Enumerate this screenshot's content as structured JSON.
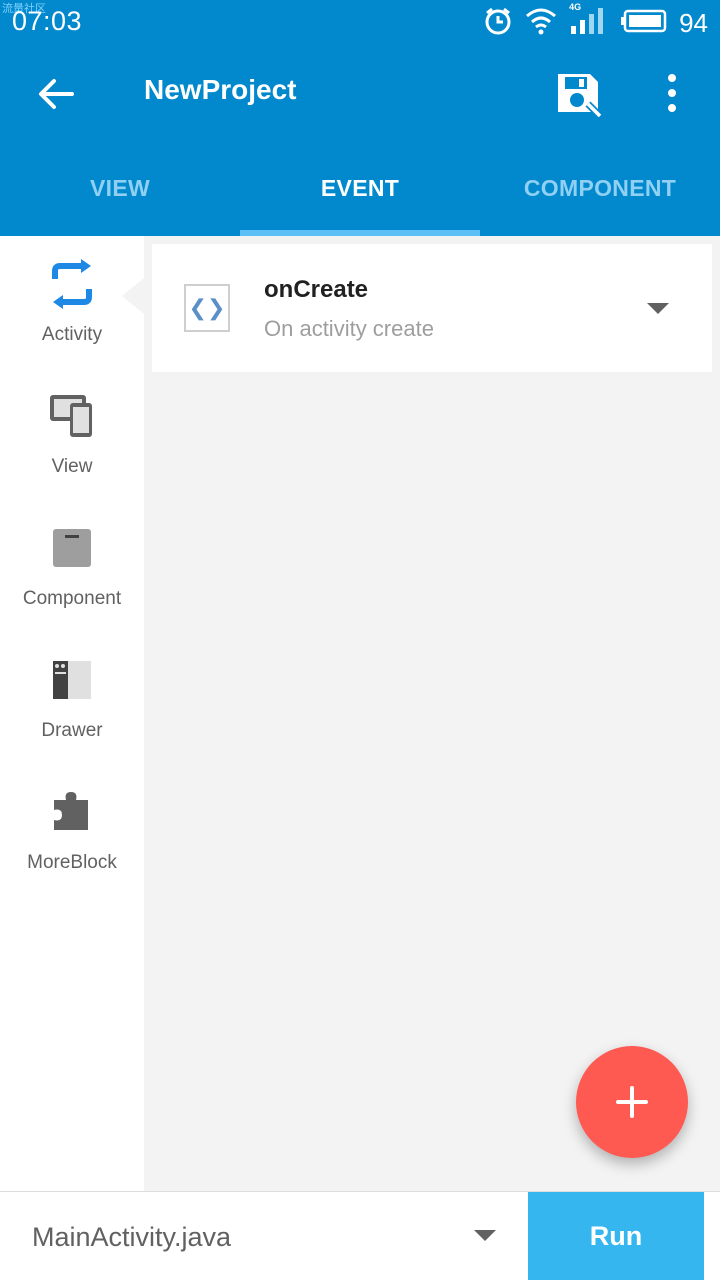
{
  "status_bar": {
    "time": "07:03",
    "watermark": "流量社区",
    "network_type": "4G",
    "battery": "94",
    "icons": [
      "alarm-icon",
      "wifi-icon",
      "signal-icon",
      "battery-icon"
    ]
  },
  "app_bar": {
    "title": "NewProject",
    "back_icon": "arrow-left-icon",
    "save_icon": "save-icon",
    "more_icon": "more-vertical-icon"
  },
  "tabs": [
    {
      "label": "VIEW",
      "active": false
    },
    {
      "label": "EVENT",
      "active": true
    },
    {
      "label": "COMPONENT",
      "active": false
    }
  ],
  "sidebar": {
    "items": [
      {
        "label": "Activity",
        "icon": "refresh-arrows-icon",
        "active": true
      },
      {
        "label": "View",
        "icon": "devices-icon",
        "active": false
      },
      {
        "label": "Component",
        "icon": "box-icon",
        "active": false
      },
      {
        "label": "Drawer",
        "icon": "drawer-icon",
        "active": false
      },
      {
        "label": "MoreBlock",
        "icon": "puzzle-icon",
        "active": false
      }
    ]
  },
  "events": [
    {
      "name": "onCreate",
      "description": "On activity create",
      "icon": "code-brackets-icon",
      "icon_text": "❮❯"
    }
  ],
  "fab": {
    "icon": "plus-icon"
  },
  "bottom_bar": {
    "file_name": "MainActivity.java",
    "run_label": "Run"
  },
  "colors": {
    "primary": "#0288cc",
    "tab_indicator": "#5bc0f5",
    "fab": "#ff5a52",
    "run_button": "#35b6ef",
    "activity_icon": "#1e88e5",
    "content_background": "#f3f3f3"
  }
}
